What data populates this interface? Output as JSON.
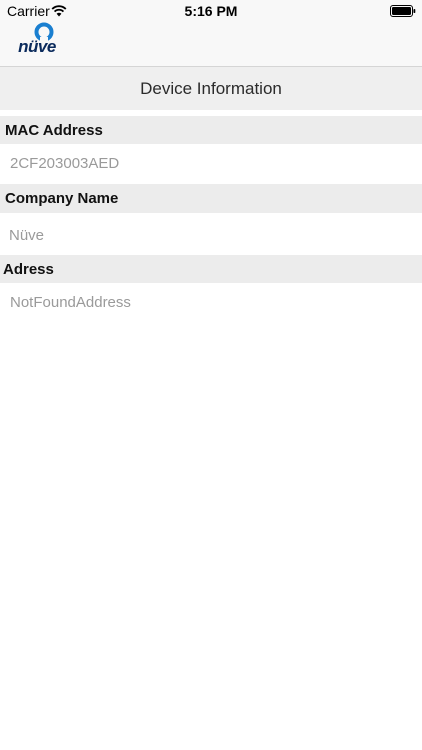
{
  "status_bar": {
    "carrier": "Carrier",
    "time": "5:16 PM"
  },
  "logo": {
    "text": "nüve"
  },
  "page": {
    "title": "Device Information"
  },
  "fields": {
    "mac": {
      "label": "MAC Address",
      "value": "2CF203003AED"
    },
    "company": {
      "label": "Company Name",
      "value": "Nüve"
    },
    "address": {
      "label": "Adress",
      "value": "NotFoundAddress"
    }
  },
  "colors": {
    "logo_blue": "#1a7fd0",
    "logo_navy": "#0a2a5c",
    "section_bg": "#ececec",
    "value_text": "#9a9a9a"
  }
}
